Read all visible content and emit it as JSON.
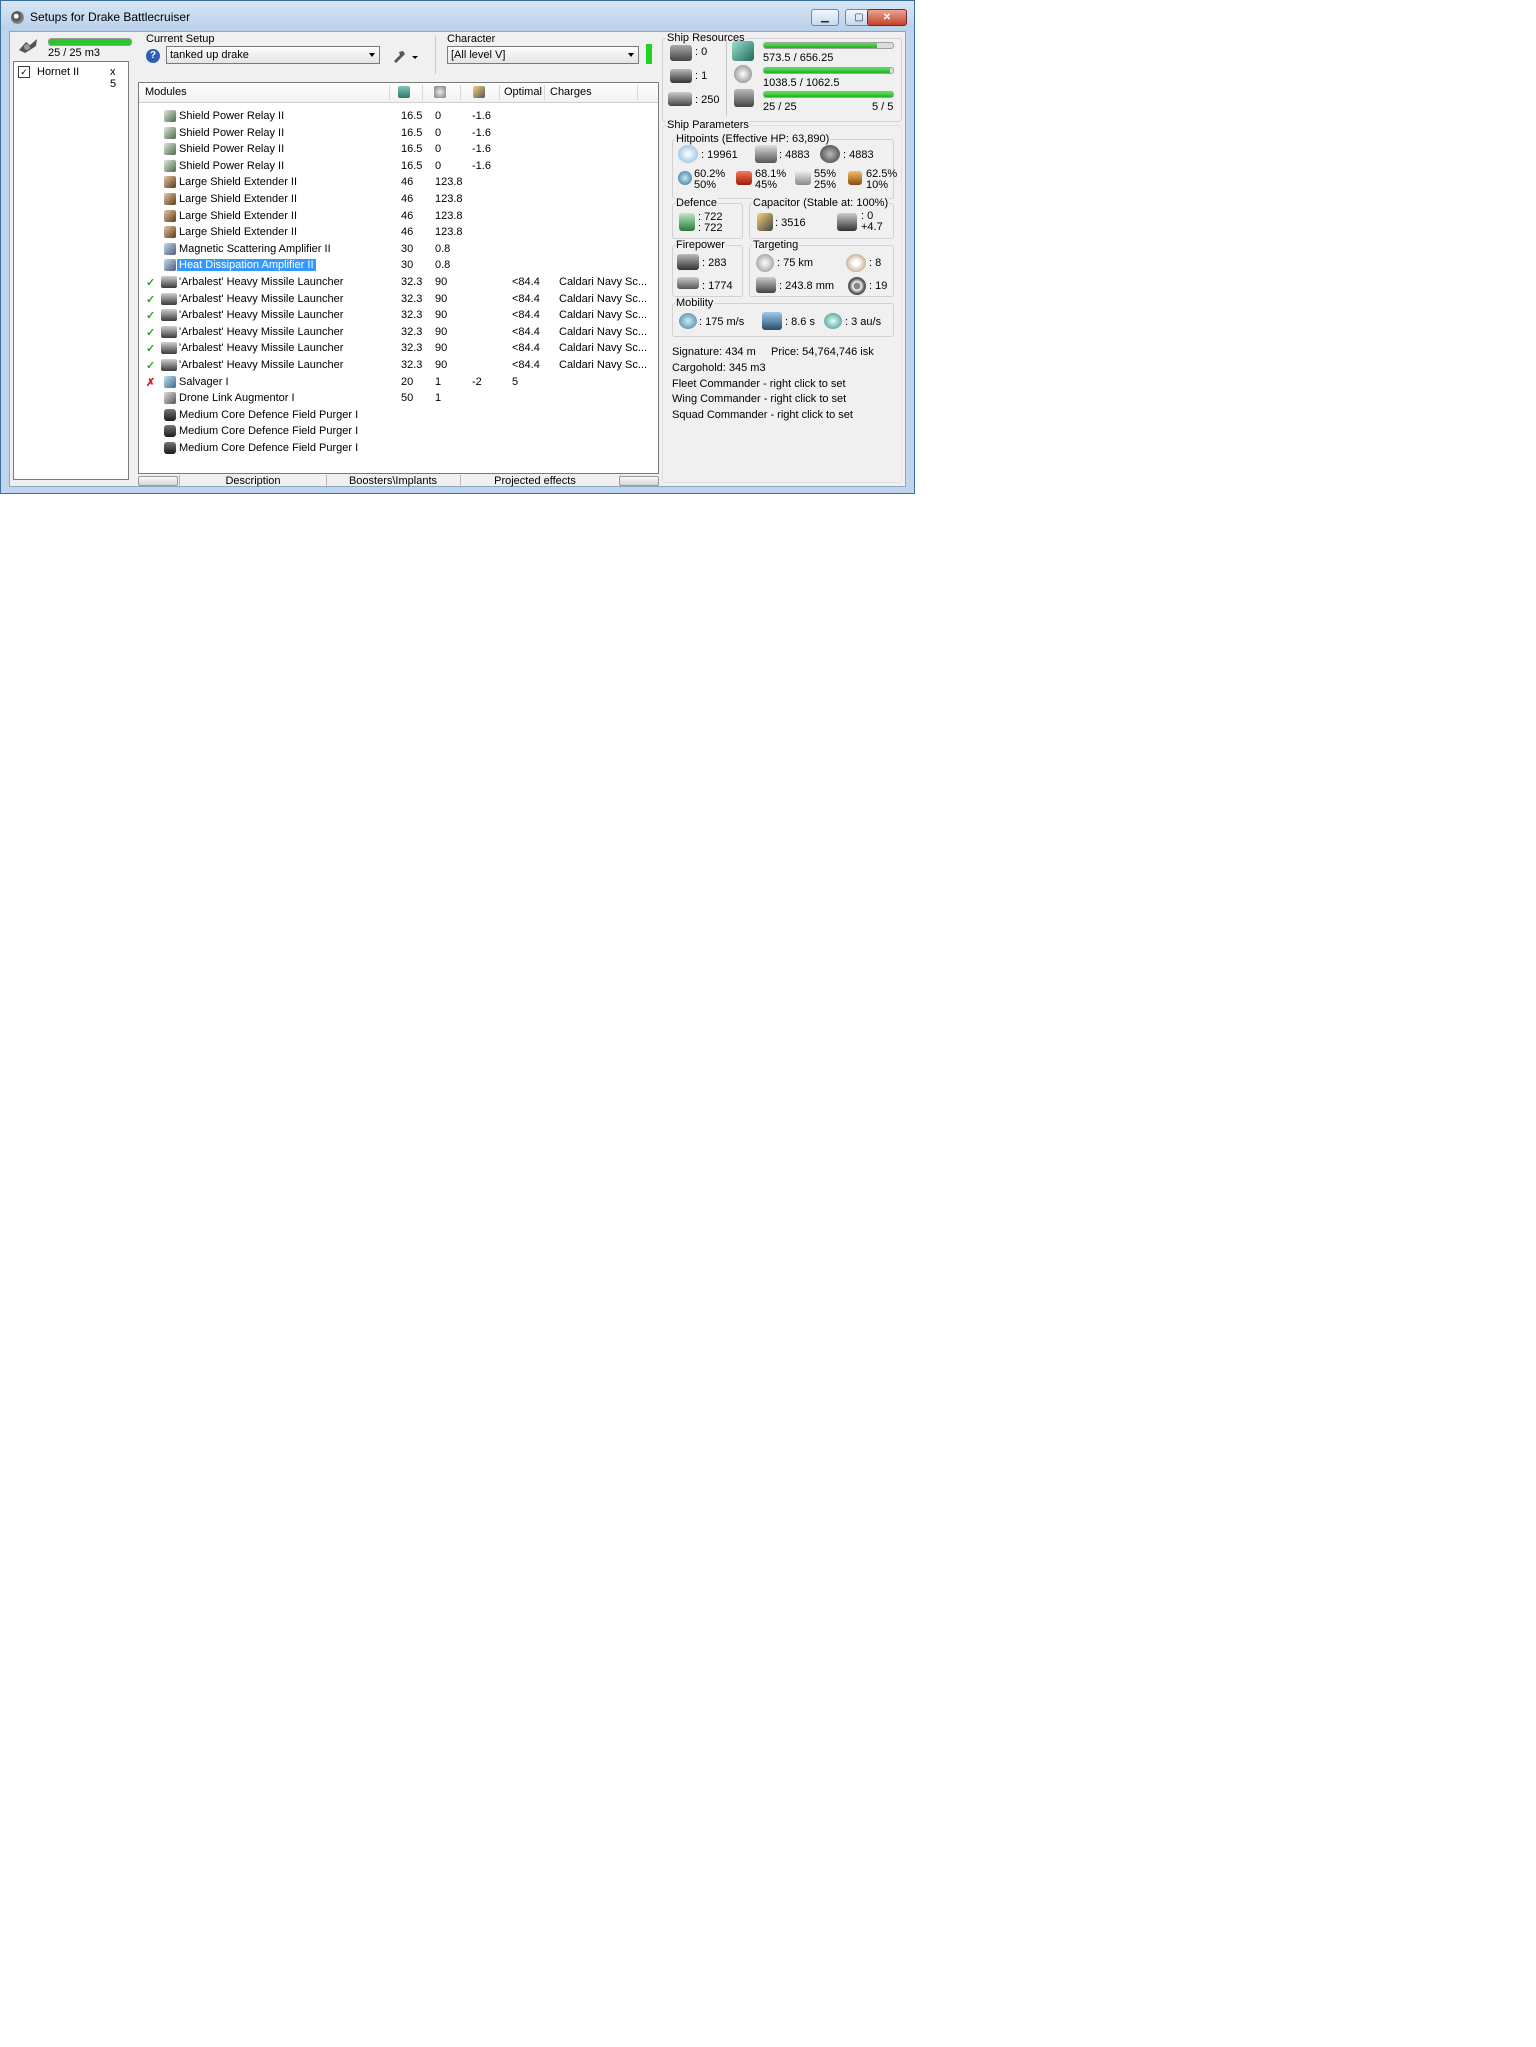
{
  "window": {
    "title": "Setups for Drake Battlecruiser"
  },
  "drones": {
    "capacity_text": "25 / 25 m3",
    "capacity_fraction": 1.0,
    "items": [
      {
        "name": "Hornet II",
        "qty": "x 5",
        "checked": true
      }
    ]
  },
  "setup": {
    "label": "Current Setup",
    "value": "tanked up drake"
  },
  "character": {
    "label": "Character",
    "value": "[All level V]"
  },
  "modules": {
    "headers": {
      "name": "Modules",
      "optimal": "Optimal",
      "charges": "Charges"
    },
    "rows": [
      {
        "status": "",
        "name": "Shield Power Relay II",
        "cpu": "16.5",
        "pg": "0",
        "cap": "-1.6",
        "optimal": "",
        "charges": "",
        "icon": "shield-relay-icon"
      },
      {
        "status": "",
        "name": "Shield Power Relay II",
        "cpu": "16.5",
        "pg": "0",
        "cap": "-1.6",
        "optimal": "",
        "charges": "",
        "icon": "shield-relay-icon"
      },
      {
        "status": "",
        "name": "Shield Power Relay II",
        "cpu": "16.5",
        "pg": "0",
        "cap": "-1.6",
        "optimal": "",
        "charges": "",
        "icon": "shield-relay-icon"
      },
      {
        "status": "",
        "name": "Shield Power Relay II",
        "cpu": "16.5",
        "pg": "0",
        "cap": "-1.6",
        "optimal": "",
        "charges": "",
        "icon": "shield-relay-icon"
      },
      {
        "status": "",
        "name": "Large Shield Extender II",
        "cpu": "46",
        "pg": "123.8",
        "cap": "",
        "optimal": "",
        "charges": "",
        "icon": "shield-extender-icon"
      },
      {
        "status": "",
        "name": "Large Shield Extender II",
        "cpu": "46",
        "pg": "123.8",
        "cap": "",
        "optimal": "",
        "charges": "",
        "icon": "shield-extender-icon"
      },
      {
        "status": "",
        "name": "Large Shield Extender II",
        "cpu": "46",
        "pg": "123.8",
        "cap": "",
        "optimal": "",
        "charges": "",
        "icon": "shield-extender-icon"
      },
      {
        "status": "",
        "name": "Large Shield Extender II",
        "cpu": "46",
        "pg": "123.8",
        "cap": "",
        "optimal": "",
        "charges": "",
        "icon": "shield-extender-icon"
      },
      {
        "status": "",
        "name": "Magnetic Scattering Amplifier II",
        "cpu": "30",
        "pg": "0.8",
        "cap": "",
        "optimal": "",
        "charges": "",
        "icon": "amplifier-icon"
      },
      {
        "status": "",
        "name": "Heat Dissipation Amplifier II",
        "cpu": "30",
        "pg": "0.8",
        "cap": "",
        "optimal": "",
        "charges": "",
        "icon": "amplifier-icon",
        "selected": true
      },
      {
        "status": "✓",
        "name": "'Arbalest' Heavy Missile Launcher",
        "cpu": "32.3",
        "pg": "90",
        "cap": "",
        "optimal": "<84.4",
        "charges": "Caldari Navy Sc...",
        "icon": "missile-launcher-icon"
      },
      {
        "status": "✓",
        "name": "'Arbalest' Heavy Missile Launcher",
        "cpu": "32.3",
        "pg": "90",
        "cap": "",
        "optimal": "<84.4",
        "charges": "Caldari Navy Sc...",
        "icon": "missile-launcher-icon"
      },
      {
        "status": "✓",
        "name": "'Arbalest' Heavy Missile Launcher",
        "cpu": "32.3",
        "pg": "90",
        "cap": "",
        "optimal": "<84.4",
        "charges": "Caldari Navy Sc...",
        "icon": "missile-launcher-icon"
      },
      {
        "status": "✓",
        "name": "'Arbalest' Heavy Missile Launcher",
        "cpu": "32.3",
        "pg": "90",
        "cap": "",
        "optimal": "<84.4",
        "charges": "Caldari Navy Sc...",
        "icon": "missile-launcher-icon"
      },
      {
        "status": "✓",
        "name": "'Arbalest' Heavy Missile Launcher",
        "cpu": "32.3",
        "pg": "90",
        "cap": "",
        "optimal": "<84.4",
        "charges": "Caldari Navy Sc...",
        "icon": "missile-launcher-icon"
      },
      {
        "status": "✓",
        "name": "'Arbalest' Heavy Missile Launcher",
        "cpu": "32.3",
        "pg": "90",
        "cap": "",
        "optimal": "<84.4",
        "charges": "Caldari Navy Sc...",
        "icon": "missile-launcher-icon"
      },
      {
        "status": "✗",
        "name": "Salvager I",
        "cpu": "20",
        "pg": "1",
        "cap": "-2",
        "optimal": "5",
        "charges": "",
        "icon": "salvager-icon"
      },
      {
        "status": "",
        "name": "Drone Link Augmentor I",
        "cpu": "50",
        "pg": "1",
        "cap": "",
        "optimal": "",
        "charges": "",
        "icon": "drone-link-icon"
      },
      {
        "status": "",
        "name": "Medium Core Defence Field Purger I",
        "cpu": "",
        "pg": "",
        "cap": "",
        "optimal": "",
        "charges": "",
        "icon": "rig-icon"
      },
      {
        "status": "",
        "name": "Medium Core Defence Field Purger I",
        "cpu": "",
        "pg": "",
        "cap": "",
        "optimal": "",
        "charges": "",
        "icon": "rig-icon"
      },
      {
        "status": "",
        "name": "Medium Core Defence Field Purger I",
        "cpu": "",
        "pg": "",
        "cap": "",
        "optimal": "",
        "charges": "",
        "icon": "rig-icon"
      }
    ]
  },
  "tabs": {
    "t1": "Description",
    "t2": "Boosters\\Implants",
    "t3": "Projected effects"
  },
  "resources": {
    "label": "Ship Resources",
    "turrets": ": 0",
    "launchers": ": 1",
    "calibration": ": 250",
    "cpu_text": "573.5 / 656.25",
    "cpu_fraction": 0.874,
    "pg_text": "1038.5 / 1062.5",
    "pg_fraction": 0.977,
    "drone_bw_text": "25 / 25",
    "drone_bw_fraction": 1.0,
    "drones_active": "5 / 5"
  },
  "params": {
    "label": "Ship Parameters",
    "hitpoints_label": "Hitpoints (Effective HP: 63,890)",
    "shield_hp": ": 19961",
    "armor_hp": ": 4883",
    "structure_hp": ": 4883",
    "em_a": "60.2%",
    "em_b": "50%",
    "th_a": "68.1%",
    "th_b": "45%",
    "ki_a": "55%",
    "ki_b": "25%",
    "ex_a": "62.5%",
    "ex_b": "10%",
    "defence_label": "Defence",
    "def_a": ": 722",
    "def_b": ": 722",
    "capacitor_label": "Capacitor (Stable at: 100%)",
    "cap_amount": ": 3516",
    "cap_a": ": 0",
    "cap_b": "+4.7",
    "firepower_label": "Firepower",
    "fp_a": ": 283",
    "fp_b": ": 1774",
    "targeting_label": "Targeting",
    "range": ": 75 km",
    "targets": ": 8",
    "scan_res": ": 243.8 mm",
    "sensor": ": 19",
    "mobility_label": "Mobility",
    "speed": ": 175 m/s",
    "align": ": 8.6 s",
    "warp": ": 3 au/s",
    "signature": "Signature: 434 m",
    "price": "Price: 54,764,746 isk",
    "cargohold": "Cargohold: 345 m3",
    "fleet": "Fleet Commander - right click to set",
    "wing": "Wing Commander - right click to set",
    "squad": "Squad Commander - right click to set"
  }
}
